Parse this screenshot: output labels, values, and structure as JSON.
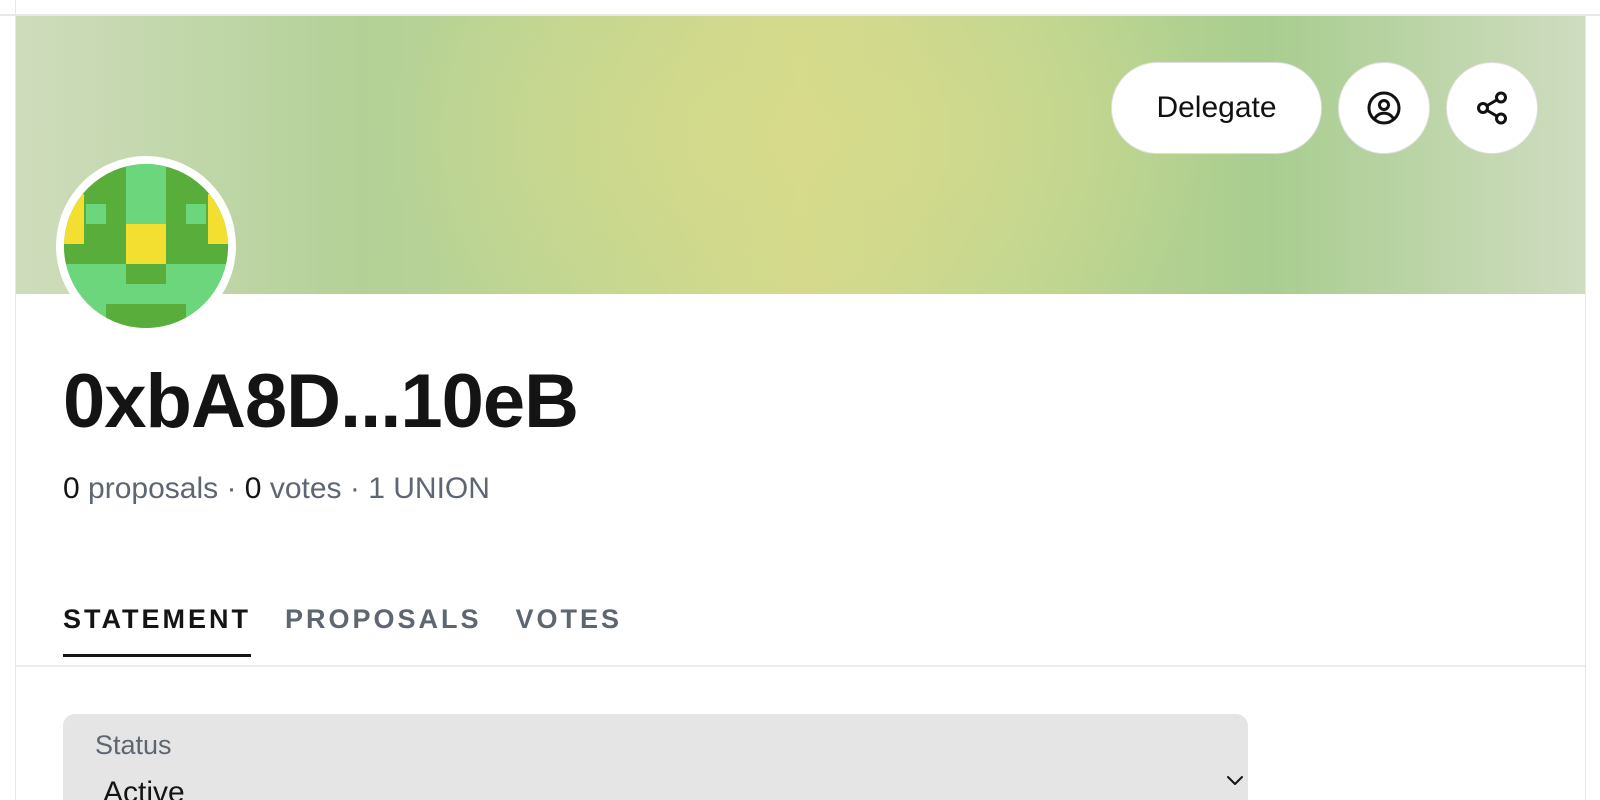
{
  "colors": {
    "text_primary": "#141414",
    "text_secondary": "#5e6671",
    "banner_green": "#b3d197",
    "banner_yellow": "#d4d98c",
    "avatar_dark_green": "#58ad3b",
    "avatar_light_green": "#6cd67c",
    "avatar_yellow": "#f3df2f",
    "select_bg": "#e5e5e5"
  },
  "header": {
    "delegate_label": "Delegate",
    "profile_icon": "user-circle-icon",
    "share_icon": "share-icon"
  },
  "profile": {
    "address": "0xbA8D...10eB",
    "stats": {
      "proposals_count": "0",
      "proposals_label": "proposals",
      "votes_count": "0",
      "votes_label": "votes",
      "separator": "·",
      "token_amount": "1 UNION"
    }
  },
  "tabs": [
    {
      "label": "STATEMENT",
      "active": true
    },
    {
      "label": "PROPOSALS",
      "active": false
    },
    {
      "label": "VOTES",
      "active": false
    }
  ],
  "status_select": {
    "label": "Status",
    "value": "Active",
    "icon": "chevron-down-icon"
  }
}
